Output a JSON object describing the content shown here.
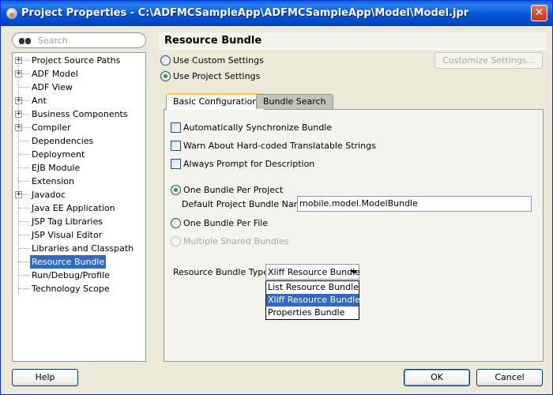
{
  "window": {
    "title": "Project Properties - C:\\ADFMCSampleApp\\ADFMCSampleApp\\Model\\Model.jpr",
    "close_symbol": "✕"
  },
  "search": {
    "placeholder": "Search"
  },
  "tree": {
    "items": [
      {
        "label": "Project Source Paths",
        "expandable": true
      },
      {
        "label": "ADF Model",
        "expandable": true
      },
      {
        "label": "ADF View",
        "expandable": false
      },
      {
        "label": "Ant",
        "expandable": true
      },
      {
        "label": "Business Components",
        "expandable": true
      },
      {
        "label": "Compiler",
        "expandable": true
      },
      {
        "label": "Dependencies",
        "expandable": false
      },
      {
        "label": "Deployment",
        "expandable": false
      },
      {
        "label": "EJB Module",
        "expandable": false
      },
      {
        "label": "Extension",
        "expandable": false
      },
      {
        "label": "Javadoc",
        "expandable": true
      },
      {
        "label": "Java EE Application",
        "expandable": false
      },
      {
        "label": "JSP Tag Libraries",
        "expandable": false
      },
      {
        "label": "JSP Visual Editor",
        "expandable": false
      },
      {
        "label": "Libraries and Classpath",
        "expandable": false
      },
      {
        "label": "Resource Bundle",
        "expandable": false,
        "selected": true
      },
      {
        "label": "Run/Debug/Profile",
        "expandable": false
      },
      {
        "label": "Technology Scope",
        "expandable": false
      }
    ],
    "expander_symbol": "+"
  },
  "panel": {
    "title": "Resource Bundle",
    "use_custom_settings": "Use Custom Settings",
    "use_project_settings": "Use Project Settings",
    "customize_button": "Customize Settings...",
    "tabs": {
      "basic": "Basic Configuration",
      "search": "Bundle Search"
    },
    "checkboxes": {
      "auto_sync": "Automatically Synchronize Bundle",
      "warn_hardcoded": "Warn About Hard-coded Translatable Strings",
      "always_prompt": "Always Prompt for Description"
    },
    "radios": {
      "one_per_project": "One Bundle Per Project",
      "one_per_file": "One Bundle Per File",
      "multiple_shared": "Multiple Shared Bundles"
    },
    "default_bundle_label": "Default Project Bundle Name:",
    "default_bundle_value": "mobile.model.ModelBundle",
    "bundle_type_label": "Resource Bundle Type:",
    "bundle_type_value": "Xliff Resource Bundle",
    "bundle_type_options": [
      "List Resource Bundle",
      "Xliff Resource Bundle",
      "Properties Bundle"
    ]
  },
  "buttons": {
    "help": "Help",
    "ok": "OK",
    "cancel": "Cancel"
  }
}
